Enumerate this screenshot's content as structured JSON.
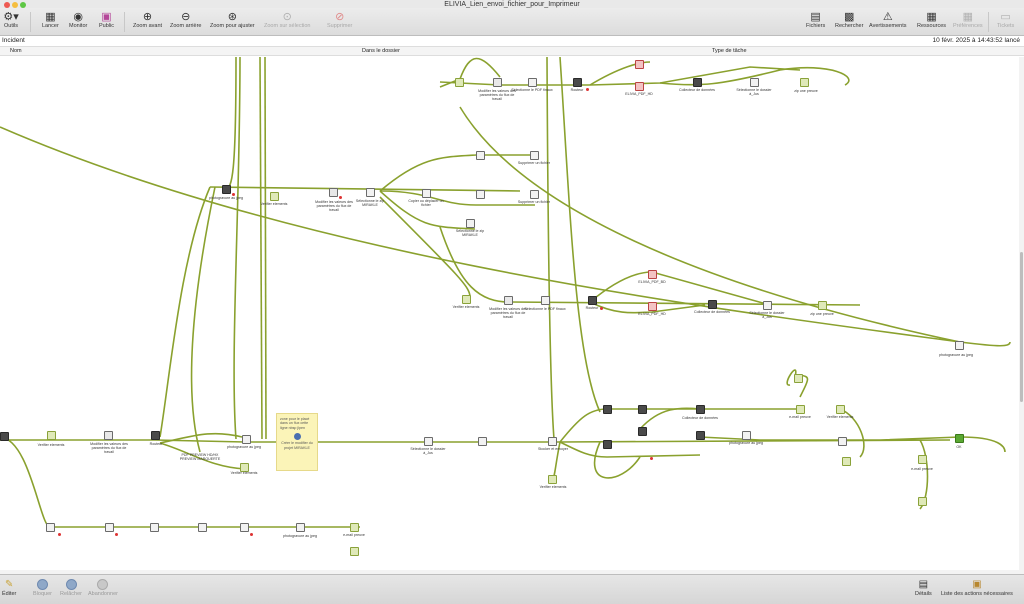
{
  "window": {
    "title": "ELIVIA_Lien_envoi_fichier_pour_Imprimeur"
  },
  "toolbar": {
    "outils": "Outils",
    "lancer": "Lancer",
    "monitor": "Monitor",
    "public": "Public",
    "zoom_avant": "Zoom avant",
    "zoom_arriere": "Zoom arrière",
    "zoom_ajuster": "Zoom pour ajuster",
    "zoom_selection": "Zoom sur sélection",
    "supprimer": "Supprimer",
    "fichiers": "Fichiers",
    "rechercher": "Rechercher",
    "avertissements": "Avertissements",
    "ressources": "Ressources",
    "preferences": "Préférences",
    "tickets": "Tickets"
  },
  "info": {
    "incident_label": "Incident",
    "launched": "10 févr. 2025 à 14:43:52 lancé"
  },
  "columns": {
    "nom": "Nom",
    "dossier": "Dans le dossier",
    "type": "Type de tâche"
  },
  "nodes": {
    "photoshop_jpeg": "photogravure au jpeg",
    "verifier_elements": "Verifier elements",
    "modifier_valeurs": "Modifier les valeurs des paramètres du flux de travail",
    "selectionner_pdf": "Sélectionne le PDF finaux",
    "routeur": "Routeur",
    "elivia_pdf_bd": "ELIVIA_PDF_BD",
    "elivia_pdf_hd": "ELIVIA_PDF_HD",
    "collecteur": "Collecteur de données",
    "selectionner_dossier": "Sélectionne le dossier à_Jus",
    "zip": "zip une preuve",
    "supprimer_fichier": "Supprimer un fichier",
    "copier_deplacer": "Copier ou déplacer un fichier",
    "selectionne_zip": "Sélectionne le zip MIRAKLE",
    "email_preuve": "e-mail preuve",
    "stocker_envoye": "Stocker et envoyer",
    "ok_label": "OK",
    "note_text": "zone pour le placé dans un flux cette ligne nbsp jlpen",
    "note_inner": "Créer le modifier du projet MIRAKLE",
    "pdf_preview": "PDF PREVIEW HD/HX PREVIEW MARQUERTE"
  },
  "bottom": {
    "editer": "Éditer",
    "bloquer": "Bloquer",
    "relacher": "Relâcher",
    "abandonner": "Abandonner",
    "details": "Détails",
    "liste_actions": "Liste des actions nécessaires"
  },
  "colors": {
    "flow_line": "#8aa12e",
    "error_dot": "#d33333"
  }
}
